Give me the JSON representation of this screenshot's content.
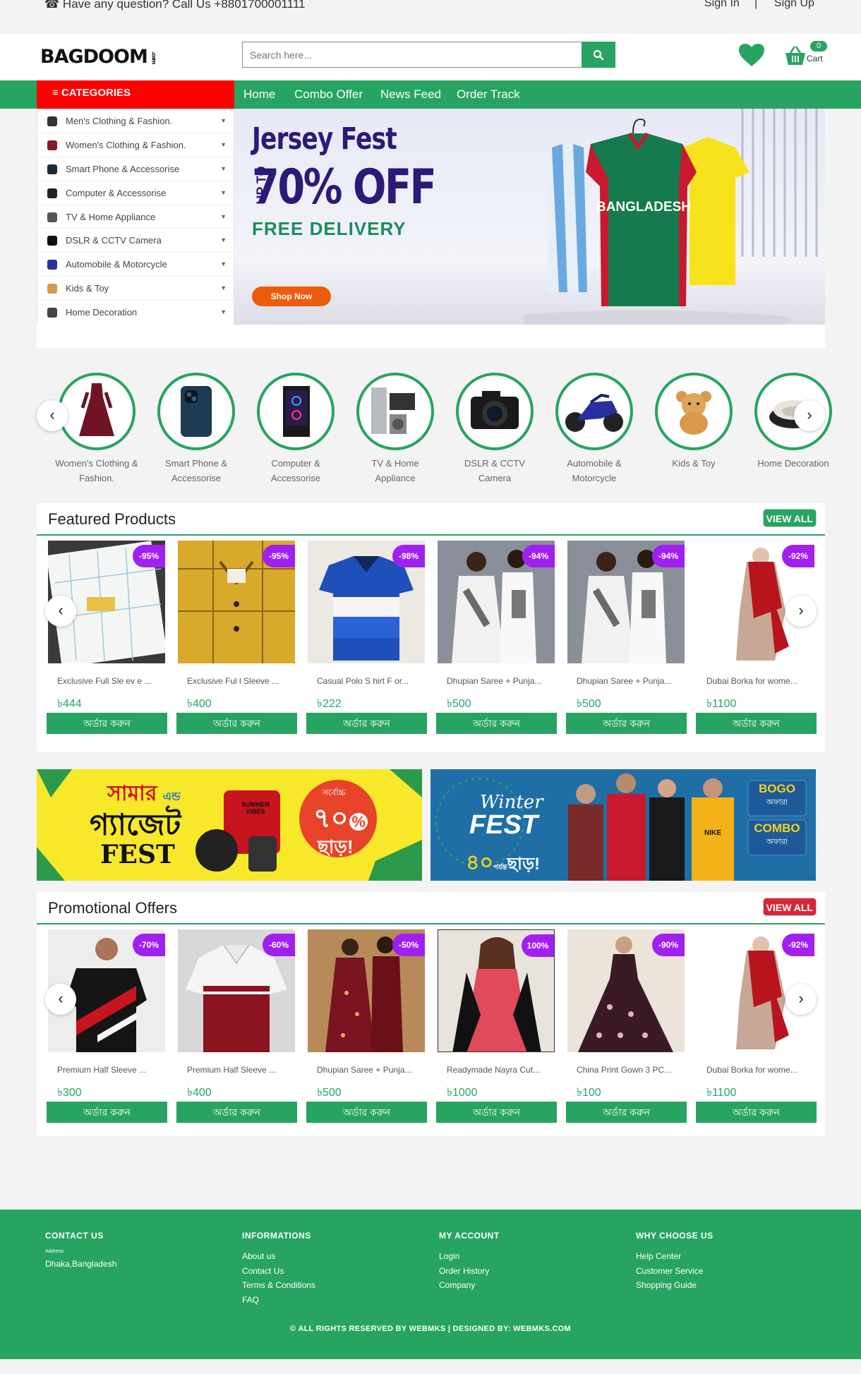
{
  "topbar": {
    "question": "Have any question? Call Us +8801700001111",
    "sign_in": "Sign In",
    "separator": "|",
    "sign_up": "Sign Up"
  },
  "header": {
    "logo": "BAGDOOM",
    "logo_suffix": ".com",
    "search_placeholder": "Search here...",
    "cart_count": "0",
    "cart_label": "Cart"
  },
  "nav": {
    "categories_label": "CATEGORIES",
    "links": [
      "Home",
      "Combo Offer",
      "News Feed",
      "Order Track"
    ]
  },
  "categories": [
    {
      "label": "Men's Clothing & Fashion.",
      "icon": "shirt-icon",
      "color": "#333"
    },
    {
      "label": "Women's Clothing & Fashion.",
      "icon": "dress-icon",
      "color": "#8b1a2b"
    },
    {
      "label": "Smart Phone & Accessorise",
      "icon": "phone-icon",
      "color": "#1d2b3a"
    },
    {
      "label": "Computer & Accessorise",
      "icon": "computer-icon",
      "color": "#222"
    },
    {
      "label": "TV & Home Appliance",
      "icon": "tv-icon",
      "color": "#555"
    },
    {
      "label": "DSLR & CCTV Camera",
      "icon": "camera-icon",
      "color": "#111"
    },
    {
      "label": "Automobile & Motorcycle",
      "icon": "motorcycle-icon",
      "color": "#2a2f9e"
    },
    {
      "label": "Kids & Toy",
      "icon": "teddy-bear-icon",
      "color": "#d8994a"
    },
    {
      "label": "Home Decoration",
      "icon": "cushion-icon",
      "color": "#444"
    }
  ],
  "hero": {
    "title": "Jersey Fest",
    "upto": "UP TO",
    "discount": "70% OFF",
    "subtitle": "FREE DELIVERY",
    "cta": "Shop Now",
    "jersey_text": "BANGLADESH"
  },
  "category_circles": [
    {
      "line1": "Women's Clothing &",
      "line2": "Fashion."
    },
    {
      "line1": "Smart Phone &",
      "line2": "Accessorise"
    },
    {
      "line1": "Computer &",
      "line2": "Accessorise"
    },
    {
      "line1": "TV & Home",
      "line2": "Appliance"
    },
    {
      "line1": "DSLR & CCTV",
      "line2": "Camera"
    },
    {
      "line1": "Automobile &",
      "line2": "Motorcycle"
    },
    {
      "line1": "Kids & Toy",
      "line2": ""
    },
    {
      "line1": "Home Decoration",
      "line2": ""
    }
  ],
  "featured": {
    "title": "Featured Products",
    "view_all": "VIEW ALL",
    "products": [
      {
        "name": "Exclusive Full Sle ev e ...",
        "price": "৳444",
        "discount": "-95%",
        "order": "অর্ডার করুন"
      },
      {
        "name": "Exclusive Ful l Sleeve ...",
        "price": "৳400",
        "discount": "-95%",
        "order": "অর্ডার করুন"
      },
      {
        "name": "Casual Polo S hirt F or...",
        "price": "৳222",
        "discount": "-98%",
        "order": "অর্ডার করুন"
      },
      {
        "name": "Dhupian Saree + Punja...",
        "price": "৳500",
        "discount": "-94%",
        "order": "অর্ডার করুন"
      },
      {
        "name": "Dhupian Saree + Punja...",
        "price": "৳500",
        "discount": "-94%",
        "order": "অর্ডার করুন"
      },
      {
        "name": "Dubai Borka for wome...",
        "price": "৳1100",
        "discount": "-92%",
        "order": "অর্ডার করুন"
      }
    ]
  },
  "promo_banners": {
    "left": {
      "line1": "সামার",
      "and": "এন্ড",
      "line2": "গ্যাজেট",
      "line3": "FEST",
      "upto": "সর্বোচ্চ",
      "percent": "৭০",
      "percent_sign": "%",
      "off": "ছাড়!",
      "shirt_text": "SUMMER VIBES"
    },
    "right": {
      "winter": "Winter",
      "fest": "FEST",
      "pct": "৪০",
      "pct_label": "পর্যন্ত",
      "off": "ছাড়!",
      "bogo": "BOGO",
      "bogo_sub": "অফার!",
      "combo": "COMBO",
      "combo_sub": "অফার!",
      "hoodie_text": "NIKE"
    }
  },
  "promotional": {
    "title": "Promotional Offers",
    "view_all": "VIEW ALL",
    "products": [
      {
        "name": "Premium Half Sleeve ...",
        "price": "৳300",
        "discount": "-70%",
        "order": "অর্ডার করুন"
      },
      {
        "name": "Premium Half Sleeve ...",
        "price": "৳400",
        "discount": "-60%",
        "order": "অর্ডার করুন"
      },
      {
        "name": "Dhupian Saree + Punja...",
        "price": "৳500",
        "discount": "-50%",
        "order": "অর্ডার করুন"
      },
      {
        "name": "Readymade Nayra Cut...",
        "price": "৳1000",
        "discount": "100%",
        "order": "অর্ডার করুন"
      },
      {
        "name": "China Print Gown 3 PC...",
        "price": "৳100",
        "discount": "-90%",
        "order": "অর্ডার করুন"
      },
      {
        "name": "Dubai Borka for wome...",
        "price": "৳1100",
        "discount": "-92%",
        "order": "অর্ডার করুন"
      }
    ]
  },
  "footer": {
    "contact": {
      "heading": "CONTACT US",
      "address_label": "Address:",
      "address": "Dhaka,Bangladesh"
    },
    "info": {
      "heading": "INFORMATIONS",
      "links": [
        "About us",
        "Contact Us",
        "Terms & Conditions",
        "FAQ"
      ]
    },
    "account": {
      "heading": "MY ACCOUNT",
      "links": [
        "Login",
        "Order History",
        "Company"
      ]
    },
    "why": {
      "heading": "WHY CHOOSE US",
      "links": [
        "Help Center",
        "Customer Service",
        "Shopping Guide"
      ]
    },
    "copyright": "© ALL RIGHTS RESERVED BY WEBMKS | DESIGNED BY: WEBMKS.COM"
  },
  "colors": {
    "brand_green": "#27a461",
    "category_red": "#ff0000",
    "discount_purple": "#a020f0",
    "hero_text": "#2b1a78",
    "cta_orange": "#ef5b0c",
    "view_all_red": "#d9253a"
  }
}
